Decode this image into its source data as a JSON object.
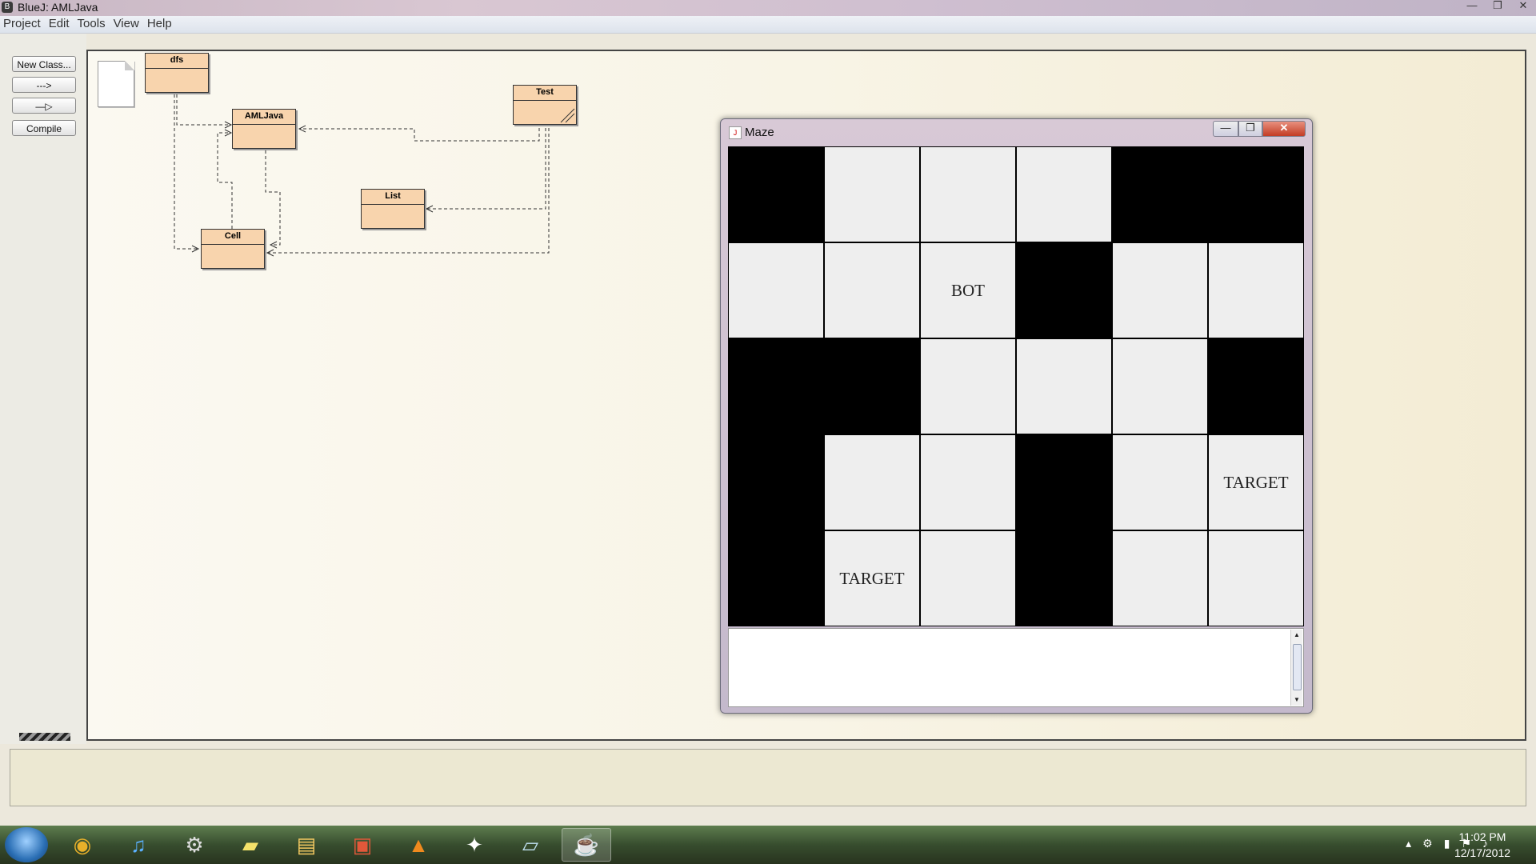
{
  "window": {
    "title": "BlueJ:  AMLJava",
    "min": "—",
    "max": "❐",
    "close": "✕"
  },
  "menu": [
    "Project",
    "Edit",
    "Tools",
    "View",
    "Help"
  ],
  "toolbar": {
    "new_class": "New Class...",
    "uses_arrow": "--->",
    "inherit_arrow": "—▷",
    "compile": "Compile"
  },
  "classes": {
    "dfs": "dfs",
    "amljava": "AMLJava",
    "test": "Test",
    "list": "List",
    "cell": "Cell"
  },
  "maze": {
    "title": "Maze",
    "btn_min": "—",
    "btn_max": "❐",
    "btn_close": "✕",
    "grid": [
      [
        "wall",
        "",
        "",
        "",
        "wall",
        "wall"
      ],
      [
        "",
        "",
        "BOT",
        "wall",
        "",
        ""
      ],
      [
        "wall",
        "wall",
        "",
        "",
        "",
        "wall"
      ],
      [
        "wall",
        "",
        "",
        "wall",
        "",
        "TARGET"
      ],
      [
        "wall",
        "TARGET",
        "",
        "wall",
        "",
        ""
      ]
    ],
    "output_text": ""
  },
  "taskbar": {
    "apps": [
      {
        "name": "chrome",
        "glyph": "◉",
        "color": "#e8b02a"
      },
      {
        "name": "itunes",
        "glyph": "♫",
        "color": "#5bb0ff"
      },
      {
        "name": "steam",
        "glyph": "⚙",
        "color": "#dddddd"
      },
      {
        "name": "sticky-notes",
        "glyph": "▰",
        "color": "#f4e26a"
      },
      {
        "name": "file-explorer",
        "glyph": "▤",
        "color": "#f3c860"
      },
      {
        "name": "powerpoint",
        "glyph": "▣",
        "color": "#e2583a"
      },
      {
        "name": "vlc",
        "glyph": "▲",
        "color": "#f08a1e"
      },
      {
        "name": "bluej",
        "glyph": "✦",
        "color": "#ffffff"
      },
      {
        "name": "notepad",
        "glyph": "▱",
        "color": "#bfe0f0"
      },
      {
        "name": "java",
        "glyph": "☕",
        "color": "#d8452a"
      }
    ],
    "time": "11:02 PM",
    "date": "12/17/2012"
  }
}
